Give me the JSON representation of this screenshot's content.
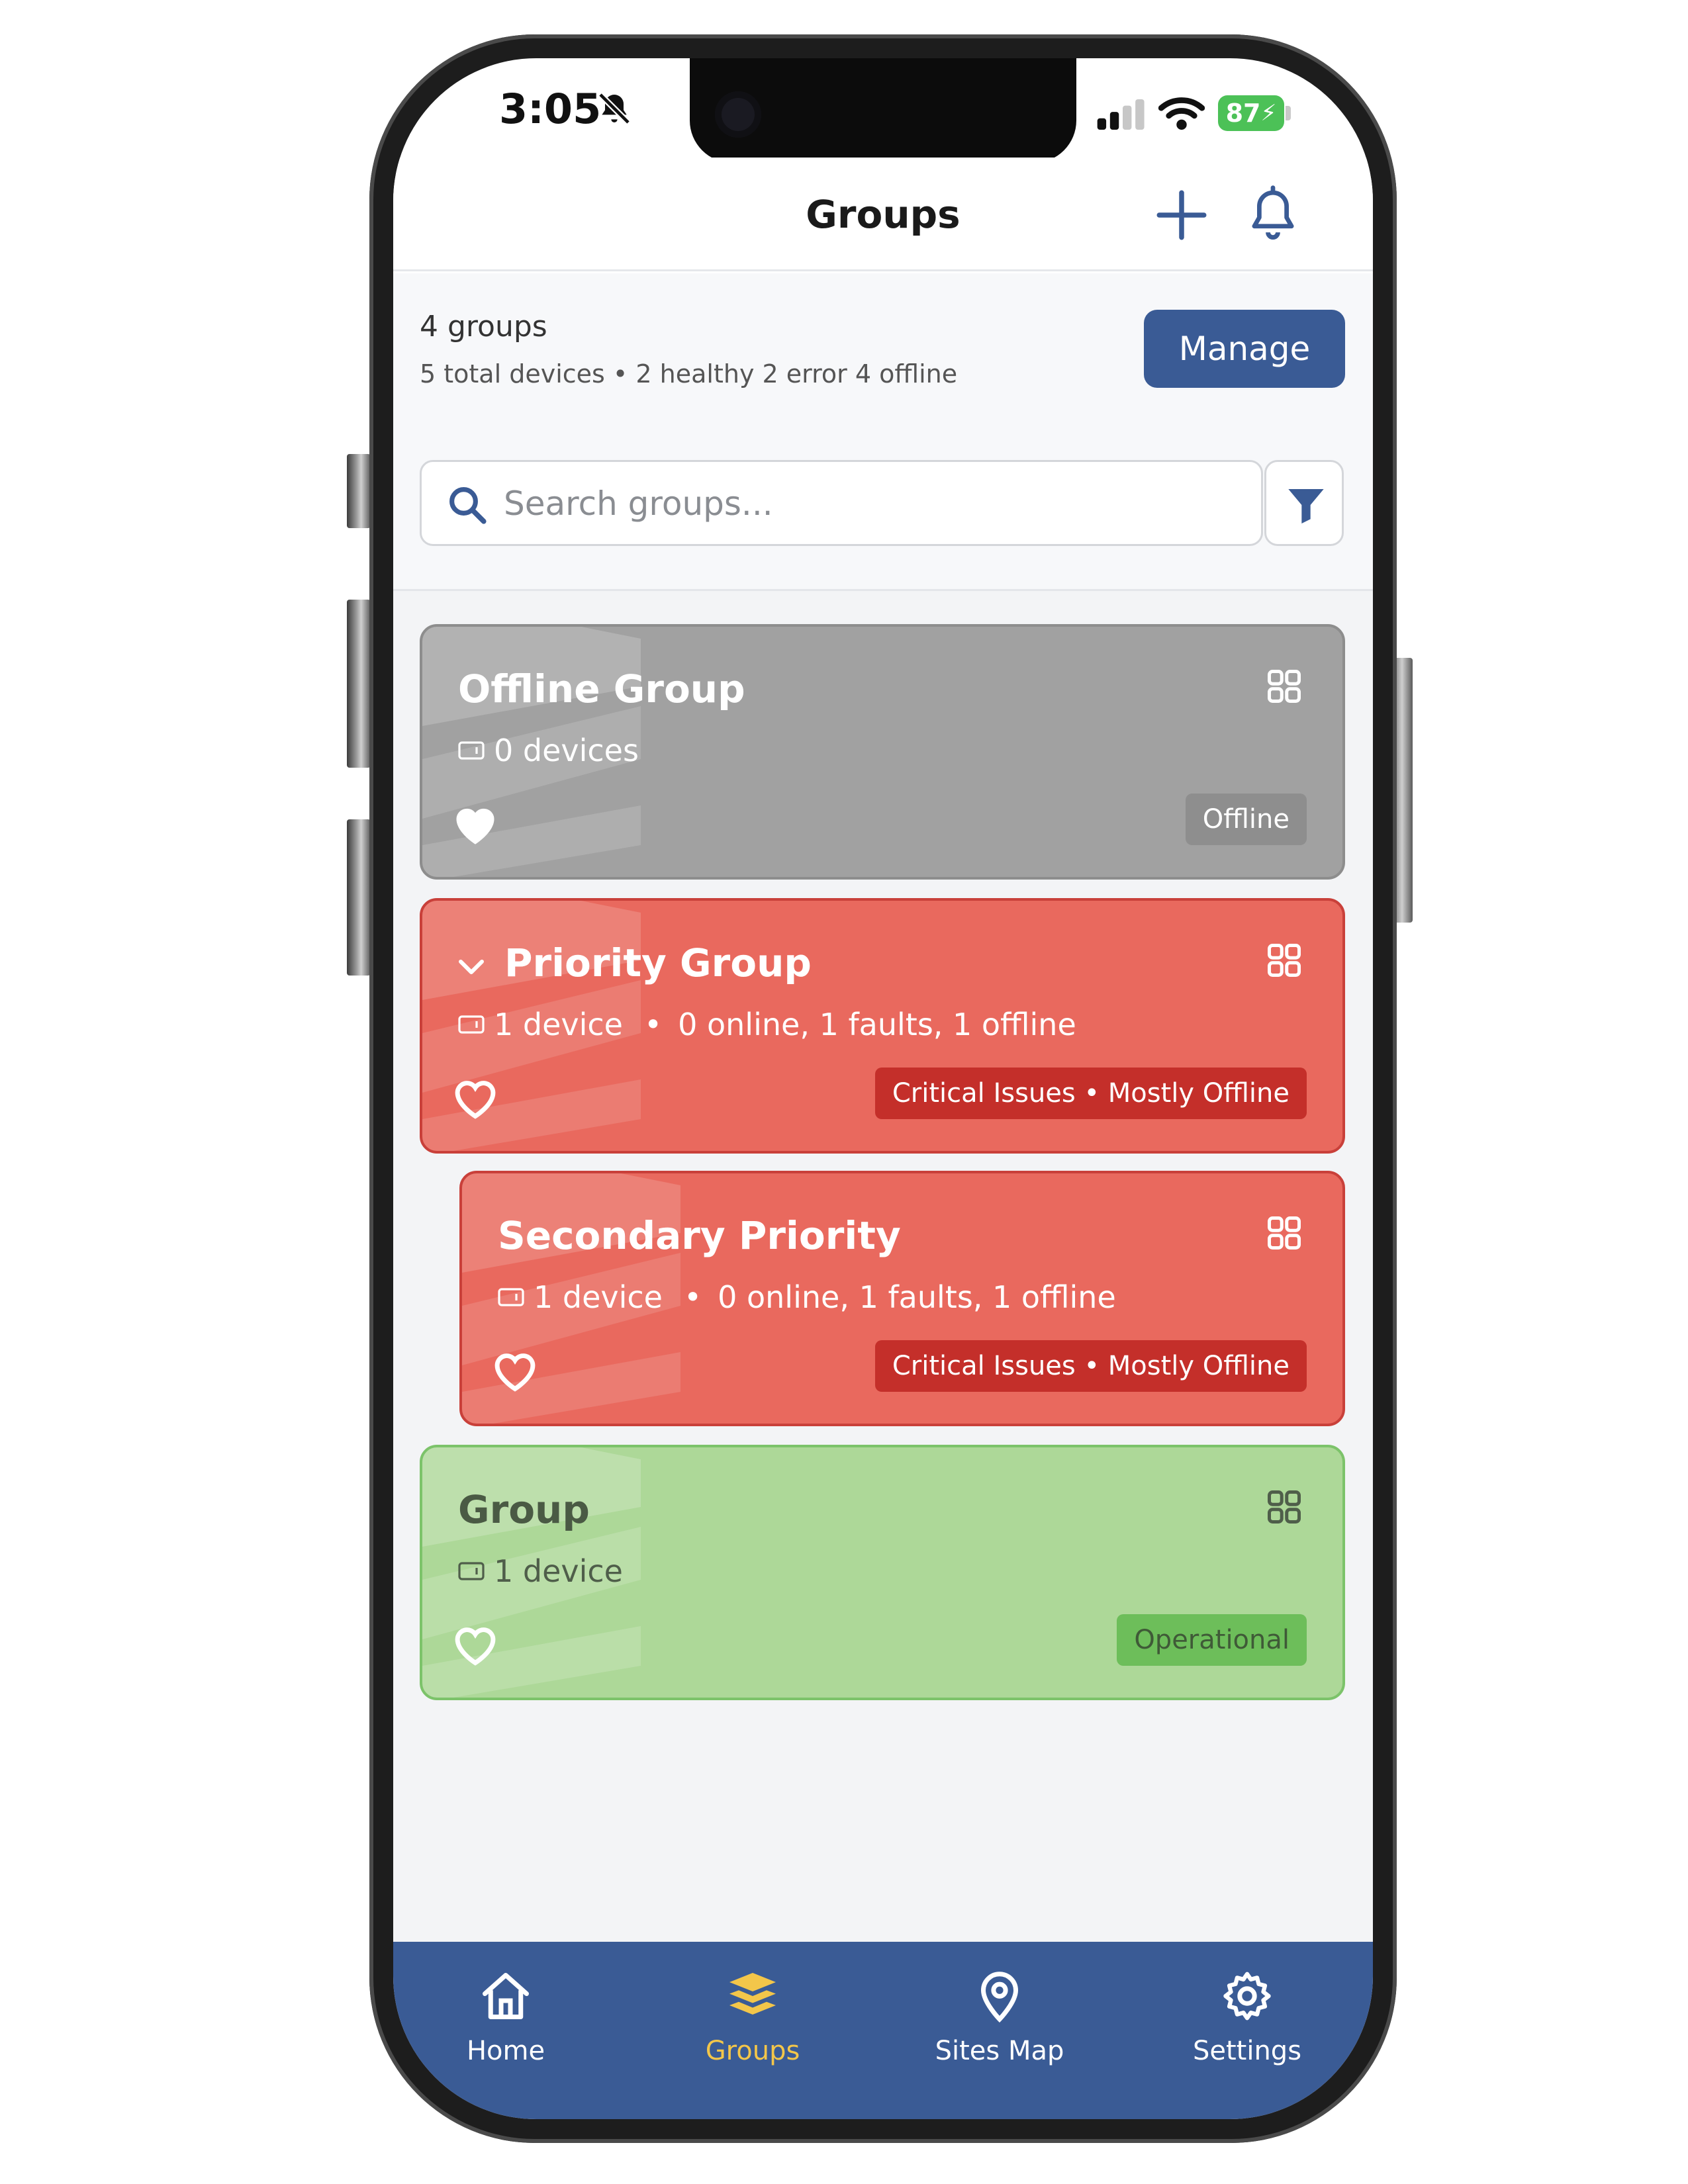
{
  "status_bar": {
    "time": "3:05",
    "battery": "87"
  },
  "header": {
    "title": "Groups"
  },
  "summary": {
    "group_count": "4 groups",
    "stats": "5 total devices • 2 healthy 2 error 4 offline",
    "manage_label": "Manage"
  },
  "search": {
    "placeholder": "Search groups..."
  },
  "groups": [
    {
      "name": "Offline Group",
      "devices": "0 devices",
      "details": "",
      "status": "Offline",
      "favorite": true,
      "color": "#a1a1a1"
    },
    {
      "name": "Priority Group",
      "devices": "1 device",
      "details": "0 online, 1 faults, 1 offline",
      "status": "Critical Issues • Mostly Offline",
      "favorite": false,
      "expanded": true,
      "color": "#e9695e"
    },
    {
      "name": "Secondary Priority",
      "devices": "1 device",
      "details": "0 online, 1 faults, 1 offline",
      "status": "Critical Issues • Mostly Offline",
      "favorite": false,
      "color": "#e9695e"
    },
    {
      "name": "Group",
      "devices": "1 device",
      "details": "",
      "status": "Operational",
      "favorite": false,
      "color": "#add898"
    }
  ],
  "tabs": [
    {
      "label": "Home",
      "icon": "home-icon",
      "active": false
    },
    {
      "label": "Groups",
      "icon": "layers-icon",
      "active": true
    },
    {
      "label": "Sites Map",
      "icon": "map-pin-icon",
      "active": false
    },
    {
      "label": "Settings",
      "icon": "gear-icon",
      "active": false
    }
  ],
  "colors": {
    "primary": "#3a5b95",
    "active_tab": "#f3c64a",
    "critical": "#c42f2a",
    "operational": "#6dbe5a"
  }
}
